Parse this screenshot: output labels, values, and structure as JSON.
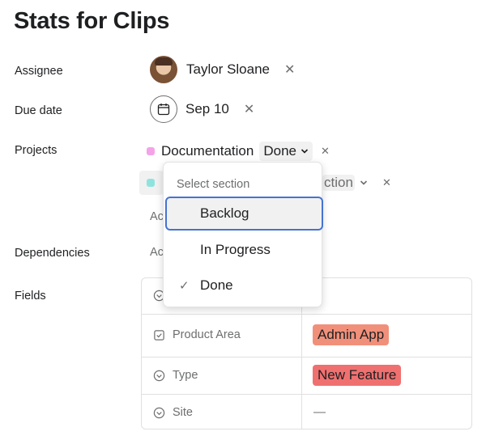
{
  "task": {
    "title": "Stats for Clips"
  },
  "labels": {
    "assignee": "Assignee",
    "due_date": "Due date",
    "projects": "Projects",
    "dependencies": "Dependencies",
    "fields": "Fields"
  },
  "assignee": {
    "name": "Taylor Sloane",
    "remove": "✕"
  },
  "due_date": {
    "value": "Sep 10",
    "remove": "✕"
  },
  "projects": [
    {
      "name": "Documentation",
      "section": "Done",
      "section_chevron": "⌄",
      "remove": "✕",
      "color": "#f5a3e8"
    },
    {
      "name_partial": "ction",
      "section_chevron": "⌄",
      "remove": "✕",
      "color": "#8ee3df"
    }
  ],
  "add_to_project_partial": "Ac",
  "add_dependency_partial": "Ac",
  "fields": [
    {
      "name": "",
      "icon": "circle-chevron-icon",
      "value": ""
    },
    {
      "name": "Product Area",
      "icon": "checkbox-icon",
      "value": "Admin App",
      "color": "#f1907a"
    },
    {
      "name": "Type",
      "icon": "circle-chevron-icon",
      "value": "New Feature",
      "color": "#f07070"
    },
    {
      "name": "Site",
      "icon": "circle-chevron-icon",
      "value": "—"
    }
  ],
  "section_menu": {
    "header": "Select section",
    "items": [
      {
        "label": "Backlog",
        "selected": false,
        "focused": true
      },
      {
        "label": "In Progress",
        "selected": false,
        "focused": false
      },
      {
        "label": "Done",
        "selected": true,
        "focused": false,
        "check": "✓"
      }
    ]
  }
}
